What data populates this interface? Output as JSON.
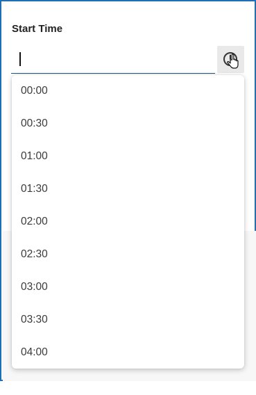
{
  "field": {
    "label": "Start Time",
    "value": "",
    "button_icon": "clock-icon"
  },
  "cursor_icon": "hand-pointer-icon",
  "colors": {
    "frame_border": "#1f6fb7",
    "input_underline": "#1f4f86",
    "button_bg": "#e9e9e9"
  },
  "dropdown": {
    "options": [
      "00:00",
      "00:30",
      "01:00",
      "01:30",
      "02:00",
      "02:30",
      "03:00",
      "03:30",
      "04:00"
    ]
  }
}
